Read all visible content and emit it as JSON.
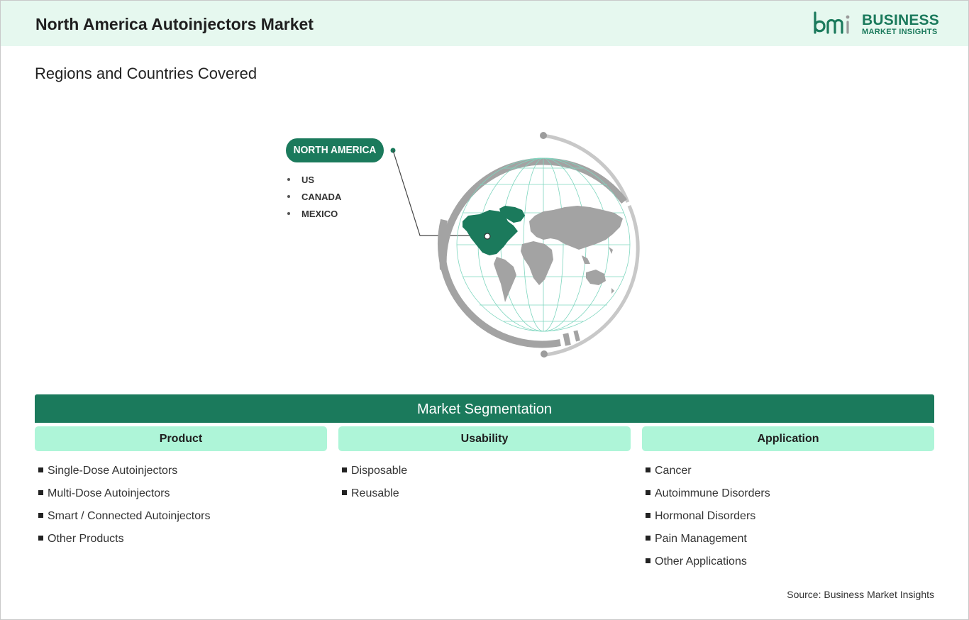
{
  "header": {
    "title": "North America Autoinjectors Market",
    "logo": {
      "mark": "bmi",
      "line1": "BUSINESS",
      "line2": "MARKET INSIGHTS"
    }
  },
  "regions": {
    "title": "Regions and Countries Covered",
    "region_label": "NORTH AMERICA",
    "countries": [
      "US",
      "CANADA",
      "MEXICO"
    ]
  },
  "segmentation": {
    "title": "Market Segmentation",
    "columns": [
      {
        "label": "Product",
        "items": [
          "Single-Dose Autoinjectors",
          "Multi-Dose Autoinjectors",
          "Smart / Connected Autoinjectors",
          "Other Products"
        ]
      },
      {
        "label": "Usability",
        "items": [
          "Disposable",
          "Reusable"
        ]
      },
      {
        "label": "Application",
        "items": [
          "Cancer",
          "Autoimmune Disorders",
          "Hormonal Disorders",
          "Pain Management",
          "Other Applications"
        ]
      }
    ]
  },
  "source": "Source: Business Market Insights",
  "colors": {
    "brand": "#1b7a5c",
    "header_bg": "#e6f8ef",
    "segment_head": "#aef5d8",
    "map_gray": "#a3a3a3"
  }
}
